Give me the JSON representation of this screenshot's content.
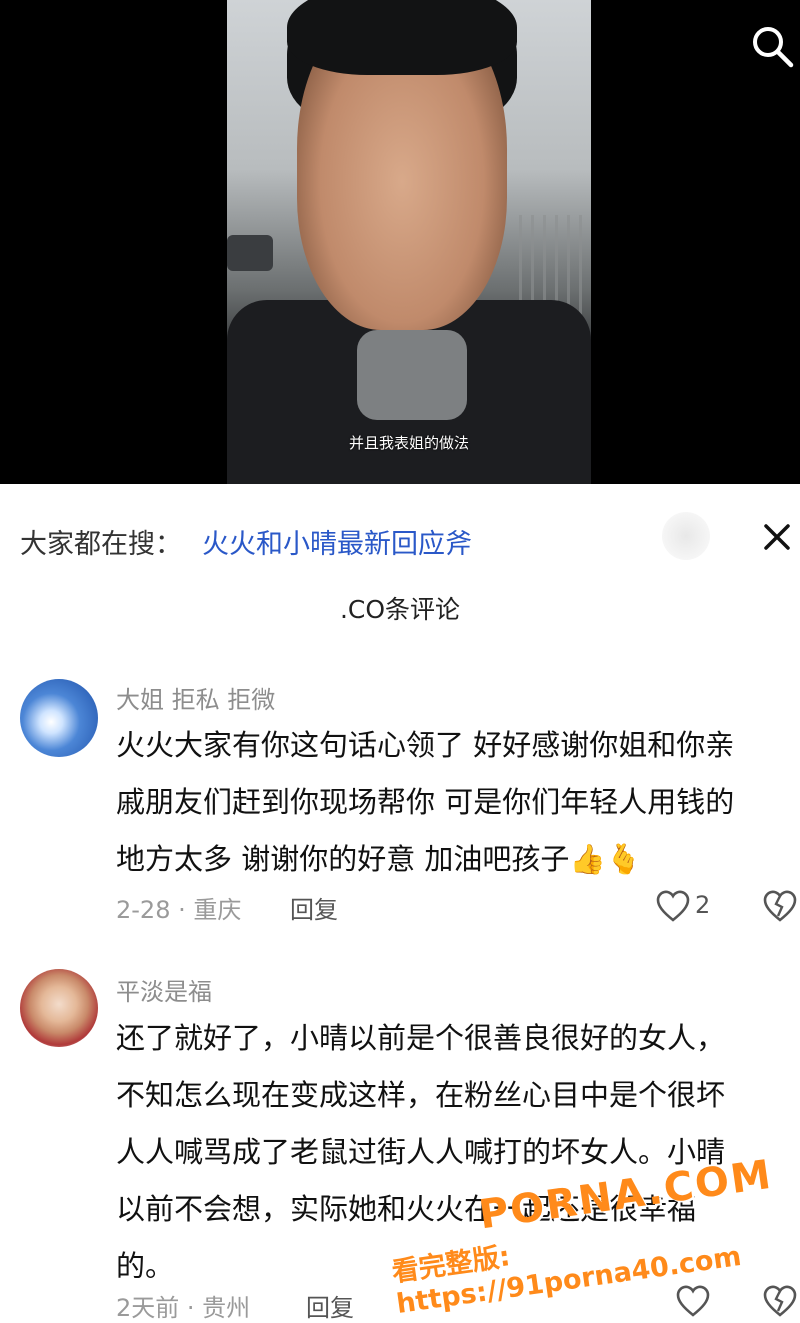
{
  "video": {
    "subtitle": "并且我表姐的做法"
  },
  "trending": {
    "prefix": "大家都在搜：",
    "link": "火火和小晴最新回应斧"
  },
  "comments_header": {
    "count_text": ".CO条评论"
  },
  "comments": [
    {
      "name": "大姐  拒私  拒微",
      "lines": [
        "火火大家有你这句话心领了 好好感谢你姐和你亲",
        "戚朋友们赶到你现场帮你 可是你们年轻人用钱的",
        "地方太多 谢谢你的好意 加油吧孩子"
      ],
      "emoji": "👍🫰",
      "meta": "2-28 · 重庆",
      "reply_label": "回复",
      "likes": "2"
    },
    {
      "name": "平淡是福",
      "lines": [
        "还了就好了，小晴以前是个很善良很好的女人，",
        "不知怎么现在变成这样，在粉丝心目中是个很坏",
        "人人喊骂成了老鼠过街人人喊打的坏女人。小晴",
        "以前不会想，实际她和火火在一起还是很幸福",
        "的。"
      ],
      "meta": "2天前 · 贵州",
      "reply_label": "回复",
      "likes": ""
    }
  ],
  "watermark": {
    "title": "PORNA.COM",
    "url": "看完整版: https://91porna40.com"
  },
  "colors": {
    "link": "#2a58c8",
    "watermark": "#ff8a1a"
  }
}
